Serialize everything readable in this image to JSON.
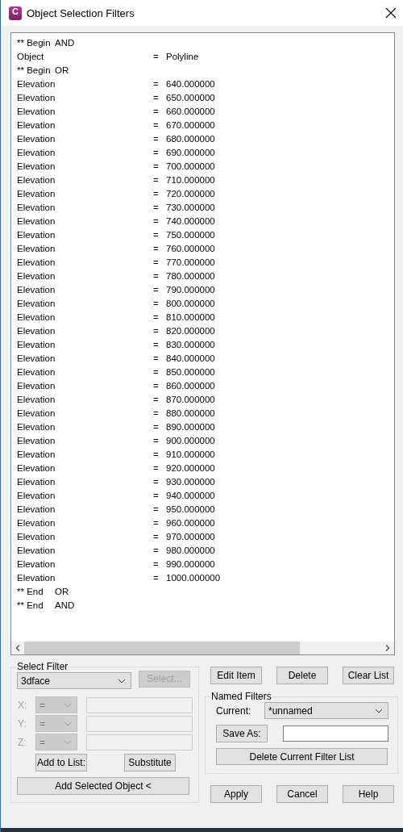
{
  "window": {
    "title": "Object Selection Filters",
    "icon_letter": "C"
  },
  "filter_list": {
    "rows": [
      {
        "kind": "marker",
        "label": "** Begin",
        "operator": "AND"
      },
      {
        "kind": "item",
        "name": "Object",
        "op": "=",
        "value": "Polyline"
      },
      {
        "kind": "marker",
        "label": "** Begin",
        "operator": "OR"
      },
      {
        "kind": "item",
        "name": "Elevation",
        "op": "=",
        "value": "640.000000"
      },
      {
        "kind": "item",
        "name": "Elevation",
        "op": "=",
        "value": "650.000000"
      },
      {
        "kind": "item",
        "name": "Elevation",
        "op": "=",
        "value": "660.000000"
      },
      {
        "kind": "item",
        "name": "Elevation",
        "op": "=",
        "value": "670.000000"
      },
      {
        "kind": "item",
        "name": "Elevation",
        "op": "=",
        "value": "680.000000"
      },
      {
        "kind": "item",
        "name": "Elevation",
        "op": "=",
        "value": "690.000000"
      },
      {
        "kind": "item",
        "name": "Elevation",
        "op": "=",
        "value": "700.000000"
      },
      {
        "kind": "item",
        "name": "Elevation",
        "op": "=",
        "value": "710.000000"
      },
      {
        "kind": "item",
        "name": "Elevation",
        "op": "=",
        "value": "720.000000"
      },
      {
        "kind": "item",
        "name": "Elevation",
        "op": "=",
        "value": "730.000000"
      },
      {
        "kind": "item",
        "name": "Elevation",
        "op": "=",
        "value": "740.000000"
      },
      {
        "kind": "item",
        "name": "Elevation",
        "op": "=",
        "value": "750.000000"
      },
      {
        "kind": "item",
        "name": "Elevation",
        "op": "=",
        "value": "760.000000"
      },
      {
        "kind": "item",
        "name": "Elevation",
        "op": "=",
        "value": "770.000000"
      },
      {
        "kind": "item",
        "name": "Elevation",
        "op": "=",
        "value": "780.000000"
      },
      {
        "kind": "item",
        "name": "Elevation",
        "op": "=",
        "value": "790.000000"
      },
      {
        "kind": "item",
        "name": "Elevation",
        "op": "=",
        "value": "800.000000"
      },
      {
        "kind": "item",
        "name": "Elevation",
        "op": "=",
        "value": "810.000000"
      },
      {
        "kind": "item",
        "name": "Elevation",
        "op": "=",
        "value": "820.000000"
      },
      {
        "kind": "item",
        "name": "Elevation",
        "op": "=",
        "value": "830.000000"
      },
      {
        "kind": "item",
        "name": "Elevation",
        "op": "=",
        "value": "840.000000"
      },
      {
        "kind": "item",
        "name": "Elevation",
        "op": "=",
        "value": "850.000000"
      },
      {
        "kind": "item",
        "name": "Elevation",
        "op": "=",
        "value": "860.000000"
      },
      {
        "kind": "item",
        "name": "Elevation",
        "op": "=",
        "value": "870.000000"
      },
      {
        "kind": "item",
        "name": "Elevation",
        "op": "=",
        "value": "880.000000"
      },
      {
        "kind": "item",
        "name": "Elevation",
        "op": "=",
        "value": "890.000000"
      },
      {
        "kind": "item",
        "name": "Elevation",
        "op": "=",
        "value": "900.000000"
      },
      {
        "kind": "item",
        "name": "Elevation",
        "op": "=",
        "value": "910.000000"
      },
      {
        "kind": "item",
        "name": "Elevation",
        "op": "=",
        "value": "920.000000"
      },
      {
        "kind": "item",
        "name": "Elevation",
        "op": "=",
        "value": "930.000000"
      },
      {
        "kind": "item",
        "name": "Elevation",
        "op": "=",
        "value": "940.000000"
      },
      {
        "kind": "item",
        "name": "Elevation",
        "op": "=",
        "value": "950.000000"
      },
      {
        "kind": "item",
        "name": "Elevation",
        "op": "=",
        "value": "960.000000"
      },
      {
        "kind": "item",
        "name": "Elevation",
        "op": "=",
        "value": "970.000000"
      },
      {
        "kind": "item",
        "name": "Elevation",
        "op": "=",
        "value": "980.000000"
      },
      {
        "kind": "item",
        "name": "Elevation",
        "op": "=",
        "value": "990.000000"
      },
      {
        "kind": "item",
        "name": "Elevation",
        "op": "=",
        "value": "1000.000000"
      },
      {
        "kind": "marker",
        "label": "** End",
        "operator": "OR"
      },
      {
        "kind": "marker",
        "label": "** End",
        "operator": "AND"
      }
    ]
  },
  "select_filter": {
    "title": "Select Filter",
    "type_value": "3dface",
    "select_button": {
      "label": "Select...",
      "disabled": true
    },
    "coords": [
      {
        "label": "X:",
        "op": "=",
        "disabled": true
      },
      {
        "label": "Y:",
        "op": "=",
        "disabled": true
      },
      {
        "label": "Z:",
        "op": "=",
        "disabled": true
      }
    ],
    "add_button": "Add to List:",
    "substitute_button": "Substitute",
    "add_selected_button": "Add Selected Object <"
  },
  "list_buttons": [
    "Edit Item",
    "Delete",
    "Clear List"
  ],
  "named_filters": {
    "title": "Named Filters",
    "current_label": "Current:",
    "current_value": "*unnamed",
    "save_as_button": "Save As:",
    "delete_button": "Delete Current Filter List"
  },
  "footer_buttons": [
    "Apply",
    "Cancel",
    "Help"
  ]
}
